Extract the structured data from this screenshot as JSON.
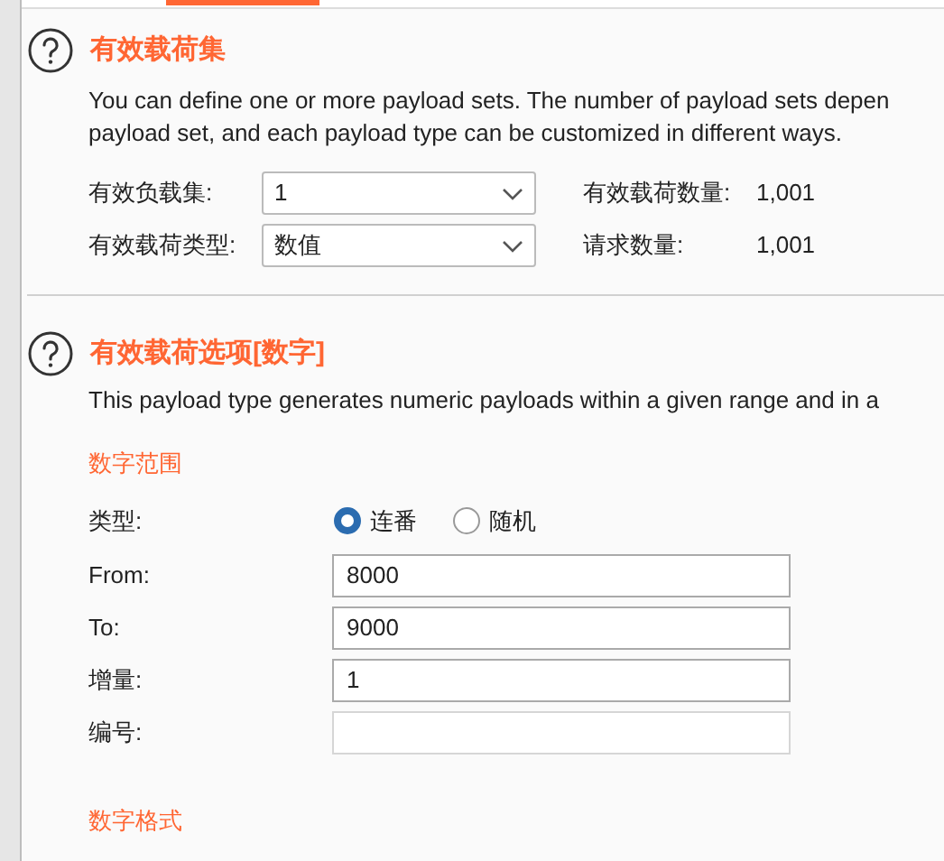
{
  "sets_section": {
    "title": "有效载荷集",
    "description": "You can define one or more payload sets. The number of payload sets depen",
    "description_line2": "payload set, and each payload type can be customized in different ways.",
    "fields": [
      {
        "label": "有效负载集:",
        "value": "1",
        "stat_label": "有效载荷数量:",
        "stat_value": "1,001"
      },
      {
        "label": "有效载荷类型:",
        "value": "数值",
        "stat_label": "请求数量:",
        "stat_value": "1,001"
      }
    ]
  },
  "options_section": {
    "title": "有效载荷选项[数字]",
    "description": "This payload type generates numeric payloads within a given range and in a",
    "range_heading": "数字范围",
    "type_label": "类型:",
    "radios": [
      {
        "label": "连番",
        "selected": true
      },
      {
        "label": "随机",
        "selected": false
      }
    ],
    "inputs": [
      {
        "label": "From:",
        "value": "8000",
        "disabled": false
      },
      {
        "label": "To:",
        "value": "9000",
        "disabled": false
      },
      {
        "label": "增量:",
        "value": "1",
        "disabled": false
      },
      {
        "label": "编号:",
        "disabled": true
      }
    ],
    "format_heading": "数字格式"
  }
}
